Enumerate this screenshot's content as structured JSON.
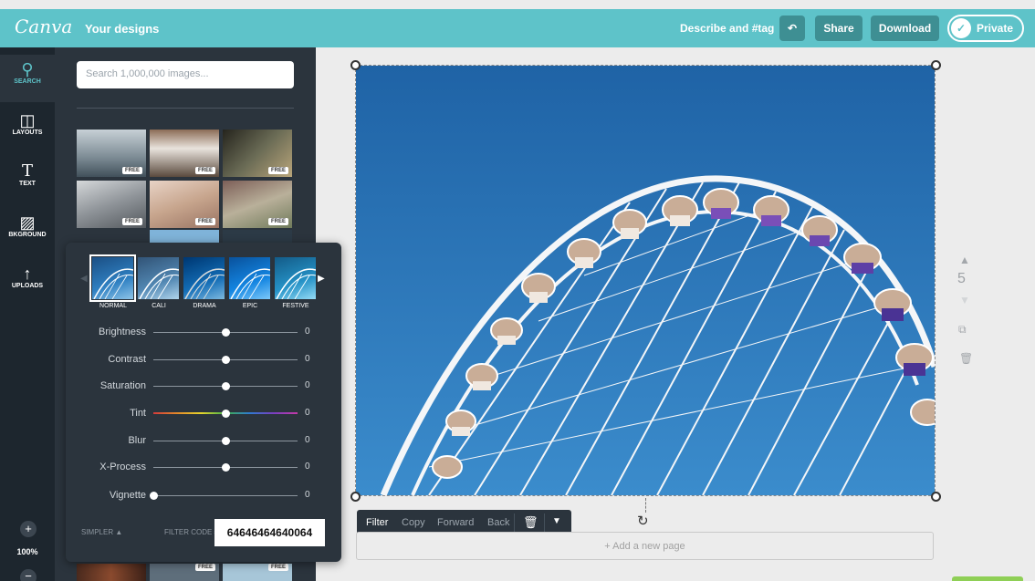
{
  "header": {
    "logo": "Canva",
    "your_designs": "Your designs",
    "describe": "Describe and #tag",
    "undo_icon": "undo-icon",
    "share": "Share",
    "download": "Download",
    "private": "Private"
  },
  "rail": {
    "items": [
      {
        "label": "SEARCH",
        "icon": "search-icon"
      },
      {
        "label": "LAYOUTS",
        "icon": "layouts-icon"
      },
      {
        "label": "TEXT",
        "icon": "text-icon"
      },
      {
        "label": "BKGROUND",
        "icon": "background-icon"
      },
      {
        "label": "UPLOADS",
        "icon": "upload-icon"
      }
    ],
    "zoom": "100%"
  },
  "panel": {
    "search_placeholder": "Search 1,000,000 images...",
    "free_badge": "FREE"
  },
  "filters": {
    "presets": [
      "NORMAL",
      "CALI",
      "DRAMA",
      "EPIC",
      "FESTIVE"
    ],
    "selected_preset": "NORMAL",
    "sliders": [
      {
        "label": "Brightness",
        "value": "0",
        "position": 0.5
      },
      {
        "label": "Contrast",
        "value": "0",
        "position": 0.5
      },
      {
        "label": "Saturation",
        "value": "0",
        "position": 0.5
      },
      {
        "label": "Tint",
        "value": "0",
        "position": 0.5
      },
      {
        "label": "Blur",
        "value": "0",
        "position": 0.5
      },
      {
        "label": "X-Process",
        "value": "0",
        "position": 0.5
      },
      {
        "label": "Vignette",
        "value": "0",
        "position": 0.0
      }
    ],
    "simpler": "SIMPLER ▲",
    "filter_code_label": "FILTER CODE #",
    "filter_code": "64646464640064"
  },
  "canvas": {
    "page_number": "5",
    "add_page": "+ Add a new page"
  },
  "context_toolbar": {
    "filter": "Filter",
    "copy": "Copy",
    "forward": "Forward",
    "back": "Back"
  },
  "colors": {
    "topbar": "#5ec3c9",
    "rail": "#1d262e",
    "panel": "#2b343d",
    "sky": "#2d7bc0"
  }
}
